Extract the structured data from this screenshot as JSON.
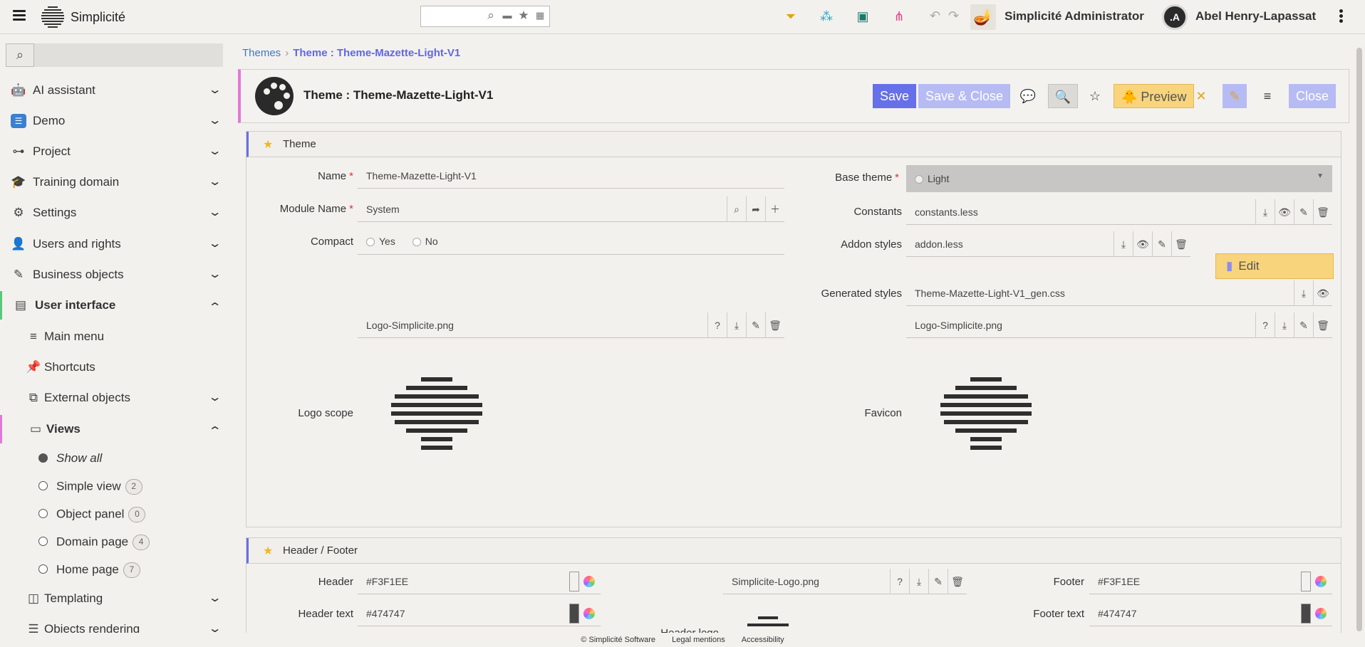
{
  "app": {
    "name": "Simplicité"
  },
  "header": {
    "admin_label": "Simplicité Administrator",
    "user_name": "Abel Henry-Lapassat",
    "avatar_text": ".A"
  },
  "sidebar": {
    "search_placeholder": "",
    "items": [
      {
        "label": "AI assistant",
        "icon": "robot-icon"
      },
      {
        "label": "Demo",
        "icon": "demo-icon"
      },
      {
        "label": "Project",
        "icon": "project-icon"
      },
      {
        "label": "Training domain",
        "icon": "graduation-cap-icon"
      },
      {
        "label": "Settings",
        "icon": "gear-icon"
      },
      {
        "label": "Users and rights",
        "icon": "user-lock-icon"
      },
      {
        "label": "Business objects",
        "icon": "tools-icon"
      },
      {
        "label": "User interface",
        "icon": "window-icon"
      }
    ],
    "sub_items": [
      {
        "label": "Main menu",
        "icon": "list-icon"
      },
      {
        "label": "Shortcuts",
        "icon": "pin-icon"
      },
      {
        "label": "External objects",
        "icon": "external-link-icon"
      },
      {
        "label": "Views",
        "icon": "window-small-icon"
      },
      {
        "label": "Templating",
        "icon": "columns-icon"
      },
      {
        "label": "Objects rendering",
        "icon": "server-icon"
      }
    ],
    "views": [
      {
        "label": "Show all",
        "count": ""
      },
      {
        "label": "Simple view",
        "count": "2"
      },
      {
        "label": "Object panel",
        "count": "0"
      },
      {
        "label": "Domain page",
        "count": "4"
      },
      {
        "label": "Home page",
        "count": "7"
      }
    ]
  },
  "breadcrumb": {
    "parent": "Themes",
    "current": "Theme : Theme-Mazette-Light-V1"
  },
  "object": {
    "title": "Theme : Theme-Mazette-Light-V1",
    "buttons": {
      "save": "Save",
      "save_close": "Save & Close",
      "preview": "Preview",
      "close": "Close"
    }
  },
  "theme_panel": {
    "title": "Theme",
    "name_label": "Name",
    "name_value": "Theme-Mazette-Light-V1",
    "module_label": "Module Name",
    "module_value": "System",
    "compact_label": "Compact",
    "compact_yes": "Yes",
    "compact_no": "No",
    "base_theme_label": "Base theme",
    "base_theme_value": "Light",
    "constants_label": "Constants",
    "constants_value": "constants.less",
    "addon_label": "Addon styles",
    "addon_value": "addon.less",
    "edit_label": "Edit",
    "generated_label": "Generated styles",
    "generated_value": "Theme-Mazette-Light-V1_gen.css",
    "logo_file": "Logo-Simplicite.png",
    "favicon_file": "Logo-Simplicite.png",
    "logo_scope_label": "Logo scope",
    "favicon_label": "Favicon"
  },
  "header_panel": {
    "title": "Header / Footer",
    "header_label": "Header",
    "header_value": "#F3F1EE",
    "header_text_label": "Header text",
    "header_text_value": "#474747",
    "header_logo_label": "Header logo",
    "header_logo_file": "Simplicite-Logo.png",
    "footer_label": "Footer",
    "footer_value": "#F3F1EE",
    "footer_text_label": "Footer text",
    "footer_text_value": "#474747"
  },
  "footer": {
    "copyright": "© Simplicité Software",
    "legal": "Legal mentions",
    "accessibility": "Accessibility"
  },
  "colors": {
    "accent": "#6670e8",
    "accent_light": "#b7bbf3",
    "preview": "#f8d47c",
    "active_bar": "#5ac87a",
    "views_bar": "#e07ad8",
    "header_swatch": "#F3F1EE",
    "text_swatch": "#474747"
  }
}
